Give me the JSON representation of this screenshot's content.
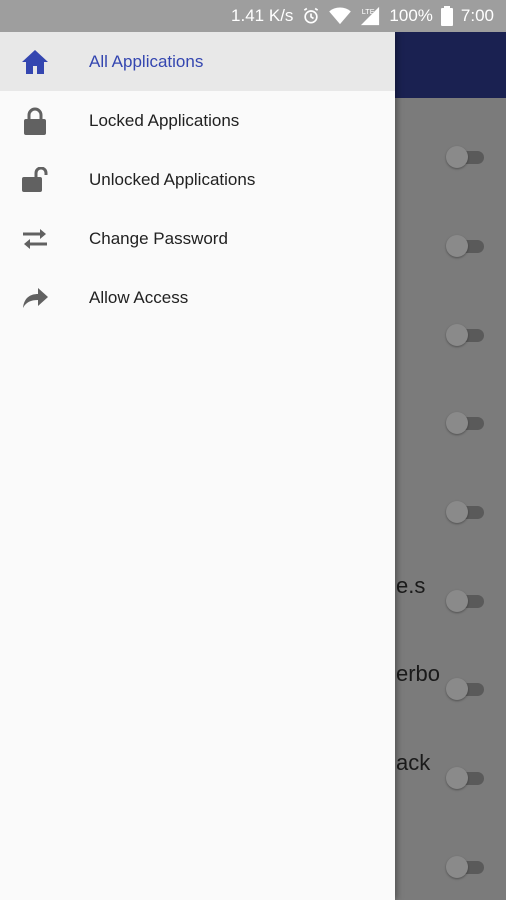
{
  "status_bar": {
    "speed": "1.41 K/s",
    "network": "LTE",
    "battery": "100%",
    "time": "7:00"
  },
  "drawer": {
    "items": [
      {
        "label": "All Applications",
        "icon": "home-icon",
        "active": true
      },
      {
        "label": "Locked Applications",
        "icon": "lock-icon",
        "active": false
      },
      {
        "label": "Unlocked Applications",
        "icon": "lock-open-icon",
        "active": false
      },
      {
        "label": "Change Password",
        "icon": "swap-icon",
        "active": false
      },
      {
        "label": "Allow Access",
        "icon": "share-icon",
        "active": false
      }
    ]
  },
  "background_list": {
    "rows": [
      {
        "label": ""
      },
      {
        "label": ""
      },
      {
        "label": ""
      },
      {
        "label": ""
      },
      {
        "label": ""
      },
      {
        "label": "e.s"
      },
      {
        "label": "erbo"
      },
      {
        "label": "ack"
      },
      {
        "label": ""
      }
    ]
  },
  "colors": {
    "toolbar": "#1a2151",
    "accent": "#3446b0",
    "drawer_bg": "#fafafa",
    "icon_gray": "#616161"
  }
}
